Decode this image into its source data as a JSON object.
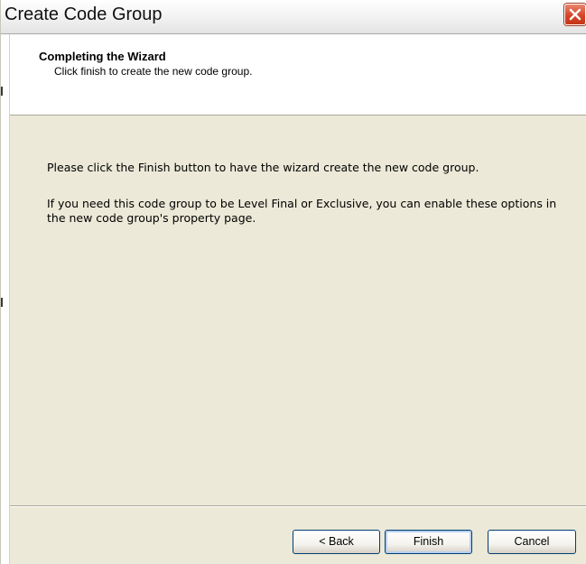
{
  "window": {
    "title": "Create Code Group"
  },
  "header": {
    "title": "Completing the Wizard",
    "subtitle": "Click finish to create the new code group."
  },
  "content": {
    "paragraph1": "Please click the Finish button to have the wizard create the new code group.",
    "paragraph2": "If you need this code group to be Level Final or Exclusive, you can enable these options in the new code group's property page."
  },
  "buttons": {
    "back": "< Back",
    "finish": "Finish",
    "cancel": "Cancel"
  },
  "icons": {
    "close": "close-icon"
  },
  "colors": {
    "dialog_background": "#ece9d8",
    "header_background": "#ffffff",
    "close_button": "#d6452a",
    "button_border": "#003c74"
  }
}
